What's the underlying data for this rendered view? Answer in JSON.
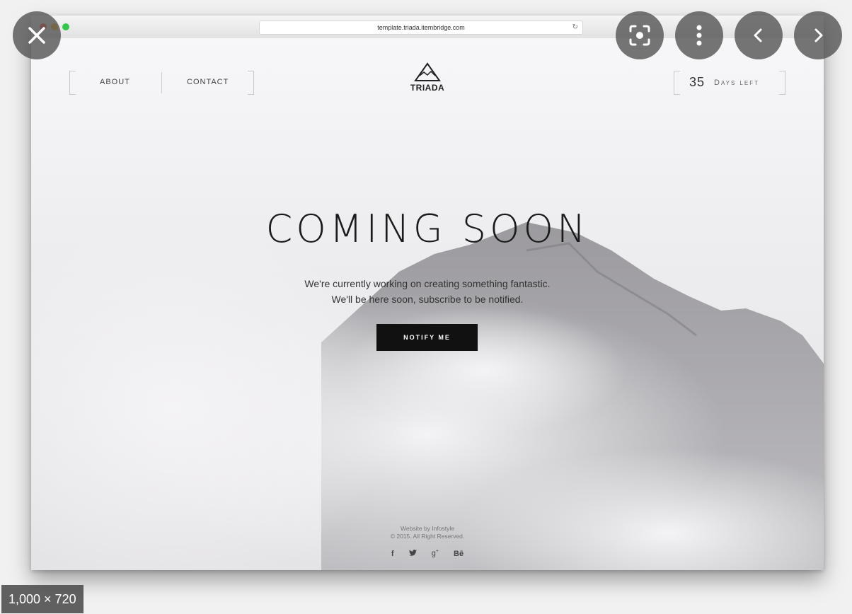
{
  "browser": {
    "url": "template.triada.itembridge.com",
    "reload_icon": "reload-icon"
  },
  "nav": {
    "about": "ABOUT",
    "contact": "CONTACT"
  },
  "logo": {
    "name": "TRIADA",
    "icon": "mountain-icon"
  },
  "countdown": {
    "number": "35",
    "label": "Days left"
  },
  "hero": {
    "title": "COMING SOON",
    "line1": "We're currently working on creating something fantastic.",
    "line2": "We'll be here soon, subscribe to be notified.",
    "button": "NOTIFY ME"
  },
  "footer": {
    "credit": "Website by Infostyle",
    "copyright": "© 2015. All Right Reserved.",
    "social": [
      "f",
      "🐦",
      "g+",
      "Bē"
    ]
  },
  "viewer": {
    "dimensions": "1,000 × 720",
    "close_icon": "close-icon",
    "lens_icon": "lens-icon",
    "more_icon": "more-vert-icon",
    "prev_icon": "chevron-left-icon",
    "next_icon": "chevron-right-icon"
  },
  "colors": {
    "button_bg": "#111111",
    "overlay": "#505050"
  }
}
